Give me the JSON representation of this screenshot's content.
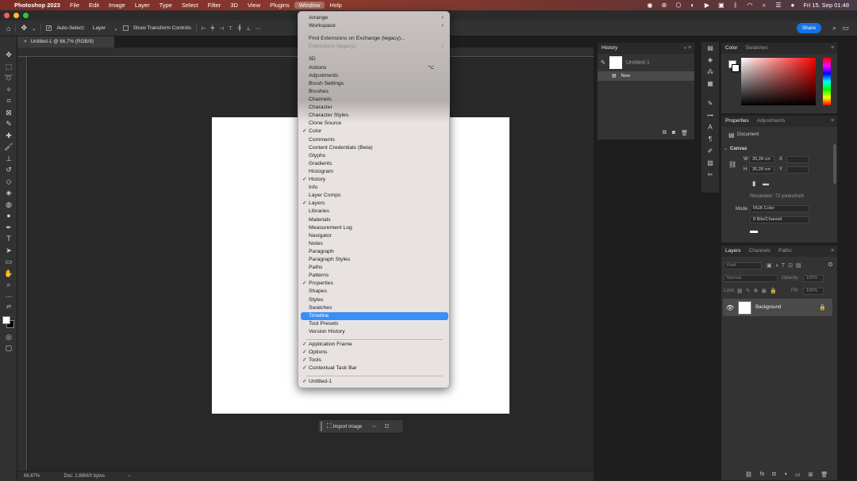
{
  "menubar": {
    "app_name": "Photoshop 2023",
    "items": [
      "File",
      "Edit",
      "Image",
      "Layer",
      "Type",
      "Select",
      "Filter",
      "3D",
      "View",
      "Plugins",
      "Window",
      "Help"
    ],
    "active_item": "Window",
    "datetime": "Fri 15. Sep  01:48"
  },
  "window_title_partial": "...",
  "options_bar": {
    "auto_select_label": "Auto-Select:",
    "auto_select_value": "Layer",
    "show_transform_label": "Show Transform Controls",
    "share_label": "Share"
  },
  "document": {
    "tab_title": "Untitled-1 @ 66,7% (RGB/8)",
    "zoom": "66,67%",
    "doc_info": "Doc: 2,66M/0 bytes"
  },
  "context_bar": {
    "import_label": "Import image"
  },
  "history": {
    "title": "History",
    "snapshot": "Untitled-1",
    "state": "New"
  },
  "color_panel": {
    "tabs": [
      "Color",
      "Swatches"
    ],
    "accent_color": "#ff0000"
  },
  "properties_panel": {
    "tabs": [
      "Properties",
      "Adjustments"
    ],
    "doc_label": "Document",
    "section": "Canvas",
    "w_label": "W",
    "w_value": "35,28 cm",
    "h_label": "H",
    "h_value": "35,28 cm",
    "x_label": "X",
    "y_label": "Y",
    "resolution": "Resolution: 72 pixels/inch",
    "mode_label": "Mode",
    "mode_value": "RGB Color",
    "depth_value": "8 Bits/Channel"
  },
  "layers_panel": {
    "tabs": [
      "Layers",
      "Channels",
      "Paths"
    ],
    "kind_label": "Kind",
    "blend_mode": "Normal",
    "opacity_label": "Opacity:",
    "opacity_value": "100%",
    "lock_label": "Lock:",
    "fill_label": "Fill:",
    "fill_value": "100%",
    "layer_name": "Background"
  },
  "window_menu": {
    "items": [
      {
        "label": "Arrange",
        "submenu": true
      },
      {
        "label": "Workspace",
        "submenu": true
      },
      {
        "sep": true
      },
      {
        "label": "Find Extensions on Exchange (legacy)..."
      },
      {
        "label": "Extensions (legacy)",
        "disabled": true,
        "submenu": true
      },
      {
        "sep": true
      },
      {
        "label": "3D"
      },
      {
        "label": "Actions",
        "shortcut": "⌥"
      },
      {
        "label": "Adjustments"
      },
      {
        "label": "Brush Settings"
      },
      {
        "label": "Brushes"
      },
      {
        "label": "Channels"
      },
      {
        "label": "Character"
      },
      {
        "label": "Character Styles"
      },
      {
        "label": "Clone Source"
      },
      {
        "label": "Color",
        "checked": true
      },
      {
        "label": "Comments"
      },
      {
        "label": "Content Credentials (Beta)"
      },
      {
        "label": "Glyphs"
      },
      {
        "label": "Gradients"
      },
      {
        "label": "Histogram"
      },
      {
        "label": "History",
        "checked": true
      },
      {
        "label": "Info"
      },
      {
        "label": "Layer Comps"
      },
      {
        "label": "Layers",
        "checked": true
      },
      {
        "label": "Libraries"
      },
      {
        "label": "Materials"
      },
      {
        "label": "Measurement Log"
      },
      {
        "label": "Navigator"
      },
      {
        "label": "Notes"
      },
      {
        "label": "Paragraph"
      },
      {
        "label": "Paragraph Styles"
      },
      {
        "label": "Paths"
      },
      {
        "label": "Patterns"
      },
      {
        "label": "Properties",
        "checked": true
      },
      {
        "label": "Shapes"
      },
      {
        "label": "Styles"
      },
      {
        "label": "Swatches"
      },
      {
        "label": "Timeline",
        "highlighted": true
      },
      {
        "label": "Tool Presets"
      },
      {
        "label": "Version History"
      },
      {
        "sep": true
      },
      {
        "label": "Application Frame",
        "checked": true
      },
      {
        "label": "Options",
        "checked": true
      },
      {
        "label": "Tools",
        "checked": true
      },
      {
        "label": "Contextual Task Bar",
        "checked": true
      },
      {
        "sep": true
      },
      {
        "label": "Untitled-1",
        "checked": true
      }
    ]
  }
}
